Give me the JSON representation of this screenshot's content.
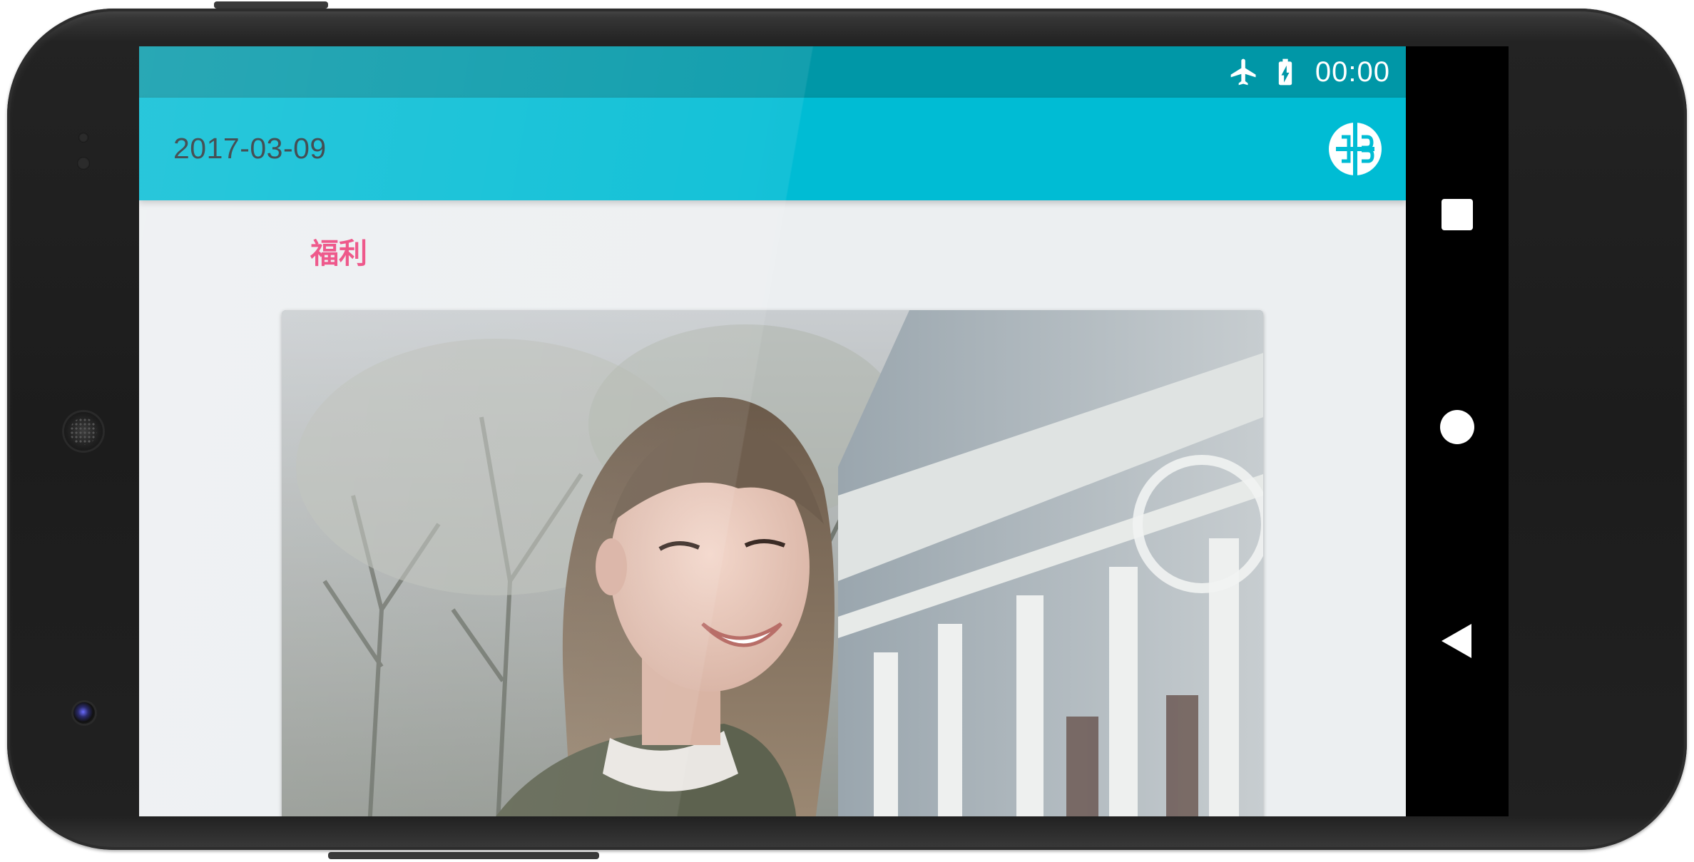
{
  "status_bar": {
    "icons": [
      "airplane-mode-icon",
      "battery-charging-icon"
    ],
    "time": "00:00"
  },
  "toolbar": {
    "title": "2017-03-09",
    "action_icon": "app-logo-icon"
  },
  "content": {
    "category": "福利",
    "photo_description_icon": "portrait-photo"
  },
  "nav_bar": {
    "buttons": [
      "recents-square-icon",
      "home-circle-icon",
      "back-triangle-icon"
    ]
  },
  "colors": {
    "status_bar": "#0097a7",
    "toolbar": "#00bcd4",
    "background": "#eceff1",
    "category_text": "#ec407a",
    "title_text": "#263238"
  }
}
